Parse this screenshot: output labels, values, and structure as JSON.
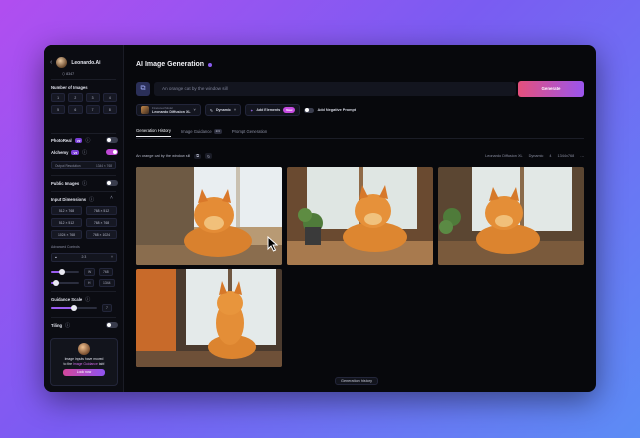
{
  "sidebar": {
    "brand": "Leonardo.Ai",
    "tokens": "8347",
    "number_of_images_label": "Number of Images",
    "image_counts": [
      "1",
      "2",
      "3",
      "4",
      "5",
      "6",
      "7",
      "8"
    ],
    "photoreal_label": "PhotoReal",
    "photoreal_badge": "V2",
    "alchemy_label": "Alchemy",
    "alchemy_badge": "V2",
    "alchemy_field_left": "Output Resolution",
    "alchemy_field_right": "1344 × 768",
    "public_images_label": "Public Images",
    "input_dimensions_label": "Input Dimensions",
    "dimensions": [
      "512 × 768",
      "768 × 512",
      "512 × 512",
      "768 × 768",
      "1024 × 768",
      "768 × 1024"
    ],
    "advanced_label": "Advanced Controls",
    "aspect_select": "2:3",
    "width_value": "W",
    "height_value": "H",
    "guidance_label": "Guidance Scale",
    "tiling_label": "Tiling",
    "promo_text_1": "Image inputs have moved",
    "promo_text_2": "to the",
    "promo_highlight": "Image Guidance",
    "promo_text_3": "tab!",
    "promo_button": "Look now"
  },
  "main": {
    "title": "AI Image Generation",
    "prompt_placeholder": "An orange cat by the window sill",
    "generate_button": "Generate",
    "model_small": "Finetuned Model",
    "model_name": "Leonardo Diffusion XL",
    "style_label": "Dynamic",
    "add_elements_label": "Add Elements",
    "new_badge": "New",
    "negative_prompt_label": "Add Negative Prompt",
    "tabs": [
      {
        "label": "Generation History",
        "count": ""
      },
      {
        "label": "Image Guidance",
        "count": "2/4"
      },
      {
        "label": "Prompt Generation",
        "count": ""
      }
    ],
    "gen_prompt": "An orange cat by the window sill",
    "gen_model": "Leonardo Diffusion XL",
    "gen_style": "Dynamic",
    "gen_count": "4",
    "gen_res": "1344x768",
    "footer_button": "Generation history"
  },
  "colors": {
    "accent": "#9a55ee",
    "generate_start": "#e4507c",
    "toggle_on": "#c048d6"
  }
}
